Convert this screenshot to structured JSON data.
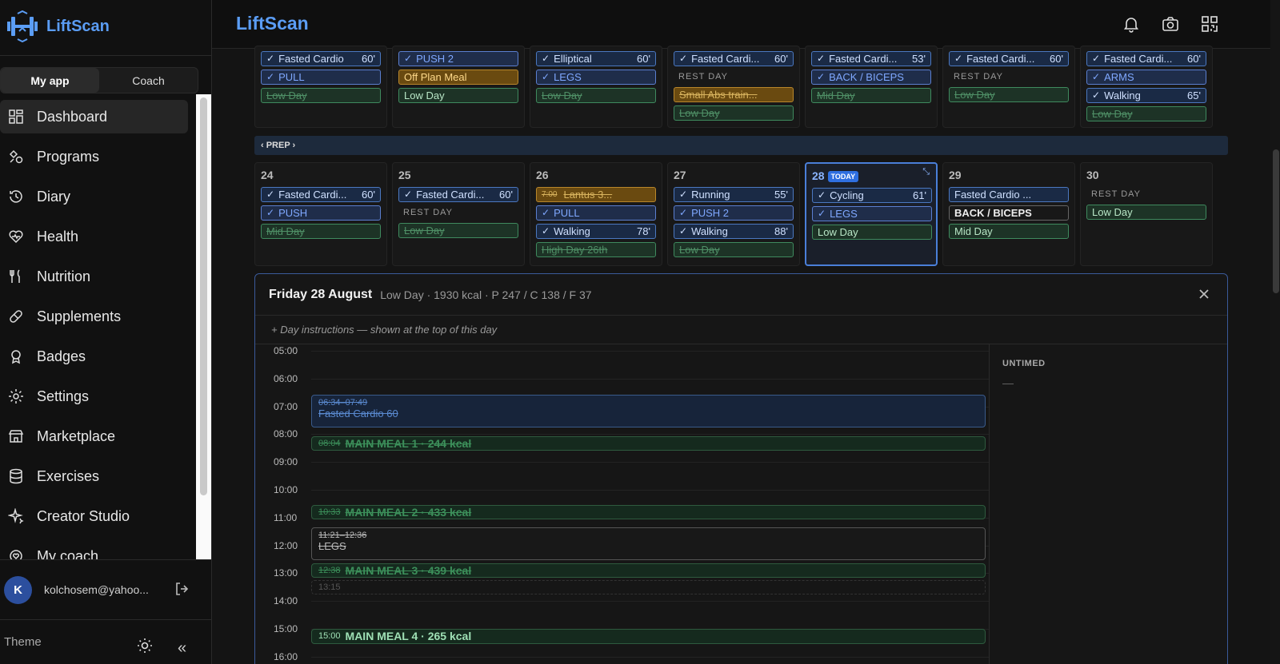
{
  "app": {
    "name": "LiftScan"
  },
  "topbar": {
    "title": "LiftScan",
    "icons": [
      "bell-icon",
      "camera-icon",
      "qr-code-icon"
    ]
  },
  "sidebar": {
    "tabs": [
      {
        "label": "My app",
        "active": true
      },
      {
        "label": "Coach",
        "active": false
      }
    ],
    "items": [
      {
        "label": "Dashboard",
        "icon": "grid-icon",
        "active": true
      },
      {
        "label": "Programs",
        "icon": "shapes-icon"
      },
      {
        "label": "Diary",
        "icon": "history-icon"
      },
      {
        "label": "Health",
        "icon": "heart-pulse-icon"
      },
      {
        "label": "Nutrition",
        "icon": "utensils-icon"
      },
      {
        "label": "Supplements",
        "icon": "pill-icon"
      },
      {
        "label": "Badges",
        "icon": "award-icon"
      },
      {
        "label": "Settings",
        "icon": "gear-icon"
      },
      {
        "label": "Marketplace",
        "icon": "store-icon"
      },
      {
        "label": "Exercises",
        "icon": "database-icon"
      },
      {
        "label": "Creator Studio",
        "icon": "sparkles-icon"
      },
      {
        "label": "My coach",
        "icon": "user-heart-icon"
      }
    ],
    "user": {
      "initial": "K",
      "email": "kolchosem@yahoo..."
    },
    "theme_label": "Theme",
    "collapse_label": "«"
  },
  "calendar": {
    "prep_label": "‹ PREP ›",
    "week1": [
      {
        "chips": [
          {
            "kind": "workout",
            "check": true,
            "text": "Fasted Cardio",
            "mins": "60'"
          },
          {
            "kind": "program",
            "check": true,
            "text": "PULL"
          },
          {
            "kind": "daytype done",
            "text": "Low Day"
          }
        ]
      },
      {
        "chips": [
          {
            "kind": "program",
            "check": true,
            "text": "PUSH 2"
          },
          {
            "kind": "meal",
            "text": "Off Plan Meal"
          },
          {
            "kind": "daytype",
            "text": "Low Day"
          }
        ]
      },
      {
        "chips": [
          {
            "kind": "workout",
            "check": true,
            "text": "Elliptical",
            "mins": "60'"
          },
          {
            "kind": "program",
            "check": true,
            "text": "LEGS"
          },
          {
            "kind": "daytype done",
            "text": "Low Day"
          }
        ]
      },
      {
        "chips": [
          {
            "kind": "workout",
            "check": true,
            "text": "Fasted Cardi...",
            "mins": "60'"
          },
          {
            "kind": "rest",
            "text": "REST DAY"
          },
          {
            "kind": "meal done",
            "text": "Small Abs train..."
          },
          {
            "kind": "daytype done",
            "text": "Low Day"
          }
        ]
      },
      {
        "chips": [
          {
            "kind": "workout",
            "check": true,
            "text": "Fasted Cardi...",
            "mins": "53'"
          },
          {
            "kind": "program",
            "check": true,
            "text": "BACK / BICEPS"
          },
          {
            "kind": "daytype done",
            "text": "Mid Day"
          }
        ]
      },
      {
        "chips": [
          {
            "kind": "workout",
            "check": true,
            "text": "Fasted Cardi...",
            "mins": "60'"
          },
          {
            "kind": "rest",
            "text": "REST DAY"
          },
          {
            "kind": "daytype done",
            "text": "Low Day"
          }
        ]
      },
      {
        "chips": [
          {
            "kind": "workout",
            "check": true,
            "text": "Fasted Cardi...",
            "mins": "60'"
          },
          {
            "kind": "program",
            "check": true,
            "text": "ARMS"
          },
          {
            "kind": "workout",
            "check": true,
            "text": "Walking",
            "mins": "65'"
          },
          {
            "kind": "daytype done",
            "text": "Low Day"
          }
        ]
      }
    ],
    "week2": [
      {
        "num": "24",
        "chips": [
          {
            "kind": "workout",
            "check": true,
            "text": "Fasted Cardi...",
            "mins": "60'"
          },
          {
            "kind": "program",
            "check": true,
            "text": "PUSH"
          },
          {
            "kind": "daytype done",
            "text": "Mid Day"
          }
        ]
      },
      {
        "num": "25",
        "chips": [
          {
            "kind": "workout",
            "check": true,
            "text": "Fasted Cardi...",
            "mins": "60'"
          },
          {
            "kind": "rest",
            "text": "REST DAY"
          },
          {
            "kind": "daytype done",
            "text": "Low Day"
          }
        ]
      },
      {
        "num": "26",
        "chips": [
          {
            "kind": "meal done",
            "time": "7:00",
            "text": "Lantus 3..."
          },
          {
            "kind": "program",
            "check": true,
            "text": "PULL"
          },
          {
            "kind": "workout",
            "check": true,
            "text": "Walking",
            "mins": "78'"
          },
          {
            "kind": "daytype done",
            "text": "High Day 26th"
          }
        ]
      },
      {
        "num": "27",
        "chips": [
          {
            "kind": "workout",
            "check": true,
            "text": "Running",
            "mins": "55'"
          },
          {
            "kind": "program",
            "check": true,
            "text": "PUSH 2"
          },
          {
            "kind": "workout",
            "check": true,
            "text": "Walking",
            "mins": "88'"
          },
          {
            "kind": "daytype done",
            "text": "Low Day"
          }
        ]
      },
      {
        "num": "28",
        "today": true,
        "today_label": "TODAY",
        "chips": [
          {
            "kind": "workout",
            "check": true,
            "text": "Cycling",
            "mins": "61'"
          },
          {
            "kind": "program",
            "check": true,
            "text": "LEGS"
          },
          {
            "kind": "daytype",
            "text": "Low Day"
          }
        ]
      },
      {
        "num": "29",
        "chips": [
          {
            "kind": "workout",
            "text": "Fasted Cardio ..."
          },
          {
            "kind": "plain",
            "text": "BACK / BICEPS"
          },
          {
            "kind": "daytype",
            "text": "Mid Day"
          }
        ]
      },
      {
        "num": "30",
        "chips": [
          {
            "kind": "rest",
            "text": "REST DAY"
          },
          {
            "kind": "daytype",
            "text": "Low Day"
          }
        ]
      }
    ]
  },
  "detail": {
    "title": "Friday 28 August",
    "summary": "Low Day · 1930 kcal · P 247 / C 138 / F 37",
    "instructions": "+ Day instructions — shown at the top of this day",
    "untimed_label": "UNTIMED",
    "untimed_empty": "—",
    "hours": [
      "05:00",
      "06:00",
      "07:00",
      "08:00",
      "09:00",
      "10:00",
      "11:00",
      "12:00",
      "13:00",
      "14:00",
      "15:00",
      "16:00"
    ],
    "events": [
      {
        "style": "blue done",
        "time": "06:34–07:49",
        "name": "Fasted Cardio 60",
        "start": 6.57,
        "end": 7.82
      },
      {
        "style": "green done",
        "time": "08:04",
        "name": "MAIN MEAL 1 · 244 kcal",
        "start": 8.07,
        "end": 8.65
      },
      {
        "style": "green done",
        "time": "10:33",
        "name": "MAIN MEAL 2 · 433 kcal",
        "start": 10.55,
        "end": 11.1
      },
      {
        "style": "gray done",
        "time": "11:21–12:36",
        "name": "LEGS",
        "start": 11.35,
        "end": 12.6
      },
      {
        "style": "green done",
        "time": "12:38",
        "name": "MAIN MEAL 3 · 439 kcal",
        "start": 12.63,
        "end": 13.2
      },
      {
        "style": "dashed",
        "time": "13:15",
        "name": "",
        "start": 13.25,
        "end": 13.75
      },
      {
        "style": "green active",
        "time": "15:00",
        "name": "MAIN MEAL 4 · 265 kcal",
        "start": 15.0,
        "end": 15.6
      }
    ]
  },
  "colors": {
    "accent": "#5b9df5",
    "today": "#2f6fe0",
    "panel_border": "#3a5a9a"
  }
}
